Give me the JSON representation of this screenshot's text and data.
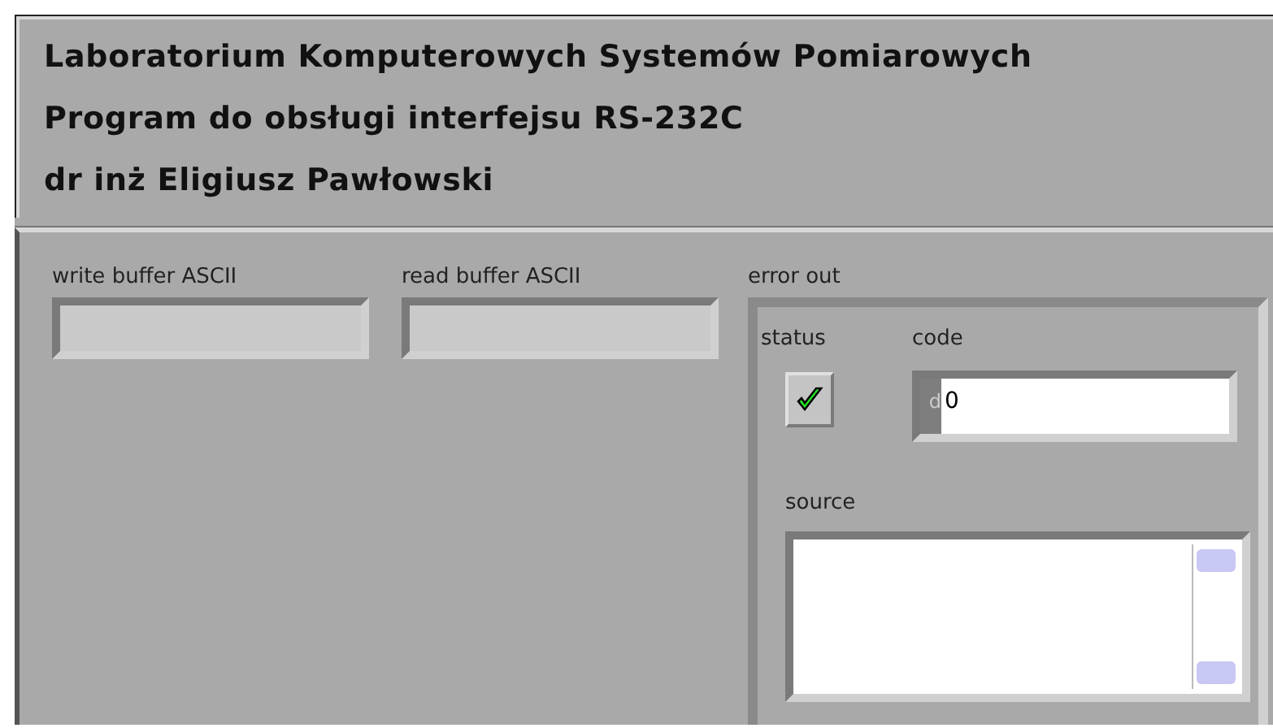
{
  "header": {
    "lines": [
      "Laboratorium Komputerowych Systemów Pomiarowych",
      "Program do obsługi interfejsu RS-232C",
      "dr inż Eligiusz Pawłowski"
    ]
  },
  "indicators": [
    {
      "label": "write buffer ASCII"
    },
    {
      "label": "read buffer ASCII"
    }
  ],
  "error_out": {
    "label": "error out",
    "status_label": "status",
    "status": true,
    "code_label": "code",
    "radix": "d",
    "code": "0",
    "source_label": "source"
  }
}
